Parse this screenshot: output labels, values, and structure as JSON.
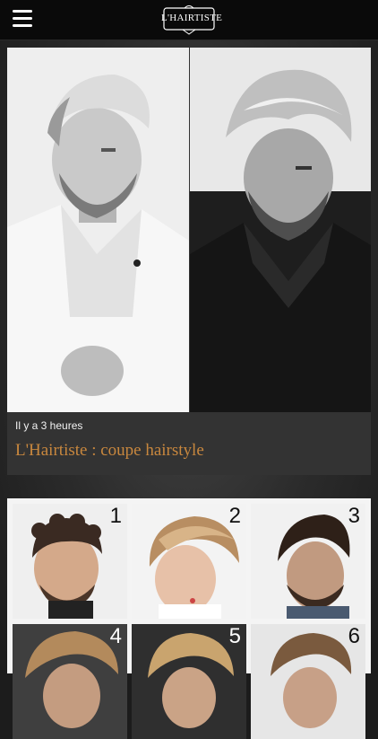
{
  "header": {
    "logo_text": "L'HAIRTISTE",
    "menu_icon": "hamburger-menu-icon"
  },
  "article": {
    "time_ago": "Il y a 3 heures",
    "title": "L'Hairtiste : coupe hairstyle"
  },
  "gallery": {
    "numbers": [
      "1",
      "2",
      "3",
      "4",
      "5",
      "6"
    ]
  },
  "colors": {
    "title_accent": "#c8873e",
    "topbar": "#0a0a0a"
  }
}
